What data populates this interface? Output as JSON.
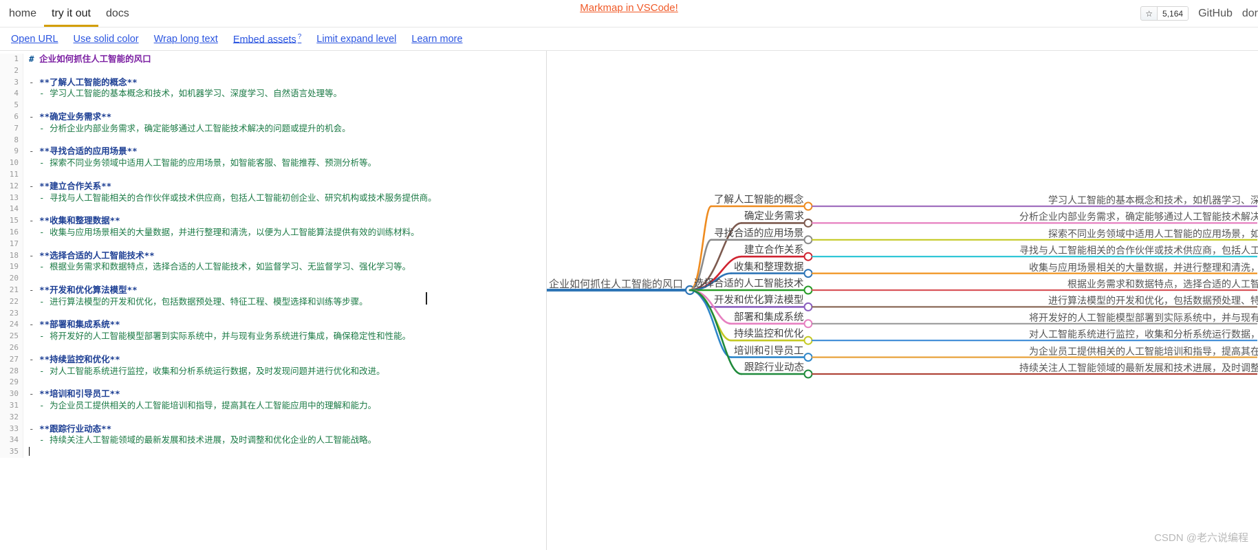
{
  "nav": {
    "items": [
      {
        "label": "home",
        "active": false
      },
      {
        "label": "try it out",
        "active": true
      },
      {
        "label": "docs",
        "active": false
      }
    ],
    "promo": "Markmap in VSCode!",
    "star_icon": "star-icon",
    "star_count": "5,164",
    "github": "GitHub",
    "donate": "dor"
  },
  "toolbar": {
    "open_url": "Open URL",
    "use_solid_color": "Use solid color",
    "wrap_long_text": "Wrap long text",
    "embed_assets": "Embed assets",
    "embed_assets_help": "?",
    "limit_expand_level": "Limit expand level",
    "learn_more": "Learn more"
  },
  "editor": {
    "lines": [
      {
        "n": "1",
        "segments": [
          {
            "t": "# ",
            "c": "tok-hash"
          },
          {
            "t": "企业如何抓住人工智能的风口",
            "c": "tok-head"
          }
        ]
      },
      {
        "n": "2",
        "segments": []
      },
      {
        "n": "3",
        "segments": [
          {
            "t": "- ",
            "c": "tok-mark"
          },
          {
            "t": "**了解人工智能的概念**",
            "c": "tok-bold"
          }
        ]
      },
      {
        "n": "4",
        "segments": [
          {
            "t": "  - 学习人工智能的基本概念和技术，如机器学习、深度学习、自然语言处理等。",
            "c": "tok-plain"
          }
        ]
      },
      {
        "n": "5",
        "segments": []
      },
      {
        "n": "6",
        "segments": [
          {
            "t": "- ",
            "c": "tok-mark"
          },
          {
            "t": "**确定业务需求**",
            "c": "tok-bold"
          }
        ]
      },
      {
        "n": "7",
        "segments": [
          {
            "t": "  - 分析企业内部业务需求，确定能够通过人工智能技术解决的问题或提升的机会。",
            "c": "tok-plain"
          }
        ]
      },
      {
        "n": "8",
        "segments": []
      },
      {
        "n": "9",
        "segments": [
          {
            "t": "- ",
            "c": "tok-mark"
          },
          {
            "t": "**寻找合适的应用场景**",
            "c": "tok-bold"
          }
        ]
      },
      {
        "n": "10",
        "segments": [
          {
            "t": "  - 探索不同业务领域中适用人工智能的应用场景，如智能客服、智能推荐、预测分析等。",
            "c": "tok-plain"
          }
        ]
      },
      {
        "n": "11",
        "segments": []
      },
      {
        "n": "12",
        "segments": [
          {
            "t": "- ",
            "c": "tok-mark"
          },
          {
            "t": "**建立合作关系**",
            "c": "tok-bold"
          }
        ]
      },
      {
        "n": "13",
        "segments": [
          {
            "t": "  - 寻找与人工智能相关的合作伙伴或技术供应商，包括人工智能初创企业、研究机构或技术服务提供商。",
            "c": "tok-plain"
          }
        ]
      },
      {
        "n": "14",
        "segments": []
      },
      {
        "n": "15",
        "segments": [
          {
            "t": "- ",
            "c": "tok-mark"
          },
          {
            "t": "**收集和整理数据**",
            "c": "tok-bold"
          }
        ]
      },
      {
        "n": "16",
        "segments": [
          {
            "t": "  - 收集与应用场景相关的大量数据，并进行整理和清洗，以便为人工智能算法提供有效的训练材料。",
            "c": "tok-plain"
          }
        ]
      },
      {
        "n": "17",
        "segments": []
      },
      {
        "n": "18",
        "segments": [
          {
            "t": "- ",
            "c": "tok-mark"
          },
          {
            "t": "**选择合适的人工智能技术**",
            "c": "tok-bold"
          }
        ]
      },
      {
        "n": "19",
        "segments": [
          {
            "t": "  - 根据业务需求和数据特点，选择合适的人工智能技术，如监督学习、无监督学习、强化学习等。",
            "c": "tok-plain"
          }
        ]
      },
      {
        "n": "20",
        "segments": []
      },
      {
        "n": "21",
        "segments": [
          {
            "t": "- ",
            "c": "tok-mark"
          },
          {
            "t": "**开发和优化算法模型**",
            "c": "tok-bold"
          }
        ]
      },
      {
        "n": "22",
        "segments": [
          {
            "t": "  - 进行算法模型的开发和优化，包括数据预处理、特征工程、模型选择和训练等步骤。",
            "c": "tok-plain"
          }
        ]
      },
      {
        "n": "23",
        "segments": []
      },
      {
        "n": "24",
        "segments": [
          {
            "t": "- ",
            "c": "tok-mark"
          },
          {
            "t": "**部署和集成系统**",
            "c": "tok-bold"
          }
        ]
      },
      {
        "n": "25",
        "segments": [
          {
            "t": "  - 将开发好的人工智能模型部署到实际系统中，并与现有业务系统进行集成，确保稳定性和性能。",
            "c": "tok-plain"
          }
        ]
      },
      {
        "n": "26",
        "segments": []
      },
      {
        "n": "27",
        "segments": [
          {
            "t": "- ",
            "c": "tok-mark"
          },
          {
            "t": "**持续监控和优化**",
            "c": "tok-bold"
          }
        ]
      },
      {
        "n": "28",
        "segments": [
          {
            "t": "  - 对人工智能系统进行监控，收集和分析系统运行数据，及时发现问题并进行优化和改进。",
            "c": "tok-plain"
          }
        ]
      },
      {
        "n": "29",
        "segments": []
      },
      {
        "n": "30",
        "segments": [
          {
            "t": "- ",
            "c": "tok-mark"
          },
          {
            "t": "**培训和引导员工**",
            "c": "tok-bold"
          }
        ]
      },
      {
        "n": "31",
        "segments": [
          {
            "t": "  - 为企业员工提供相关的人工智能培训和指导，提高其在人工智能应用中的理解和能力。",
            "c": "tok-plain"
          }
        ]
      },
      {
        "n": "32",
        "segments": []
      },
      {
        "n": "33",
        "segments": [
          {
            "t": "- ",
            "c": "tok-mark"
          },
          {
            "t": "**跟踪行业动态**",
            "c": "tok-bold"
          }
        ]
      },
      {
        "n": "34",
        "segments": [
          {
            "t": "  - 持续关注人工智能领域的最新发展和技术进展，及时调整和优化企业的人工智能战略。",
            "c": "tok-plain"
          }
        ]
      },
      {
        "n": "35",
        "segments": [
          {
            "t": "",
            "c": "tok-plain",
            "caret": true
          }
        ]
      }
    ]
  },
  "mindmap": {
    "root": {
      "label": "企业如何抓住人工智能的风口",
      "color": "#2e75b6"
    },
    "branches": [
      {
        "label": "了解人工智能的概念",
        "color": "#ee8b1f",
        "node_color": "#ee8b1f",
        "child": {
          "label": "学习人工智能的基本概念和技术，如机器学习、深",
          "color": "#a06fbe"
        }
      },
      {
        "label": "确定业务需求",
        "color": "#7d5a4f",
        "node_color": "#7d5a4f",
        "child": {
          "label": "分析企业内部业务需求，确定能够通过人工智能技术解决",
          "color": "#e67fc0"
        }
      },
      {
        "label": "寻找合适的应用场景",
        "color": "#8a8a8a",
        "node_color": "#8a8a8a",
        "child": {
          "label": "探索不同业务领域中适用人工智能的应用场景，如",
          "color": "#c4c923"
        }
      },
      {
        "label": "建立合作关系",
        "color": "#cf2330",
        "node_color": "#cf2330",
        "child": {
          "label": "寻找与人工智能相关的合作伙伴或技术供应商，包括人工",
          "color": "#24c3d4"
        }
      },
      {
        "label": "收集和整理数据",
        "color": "#2e75b6",
        "node_color": "#2e75b6",
        "child": {
          "label": "收集与应用场景相关的大量数据，并进行整理和清洗，",
          "color": "#f0931f"
        }
      },
      {
        "label": "选择合适的人工智能技术",
        "color": "#279b27",
        "node_color": "#279b27",
        "child": {
          "label": "根据业务需求和数据特点，选择合适的人工智",
          "color": "#d9545a"
        }
      },
      {
        "label": "开发和优化算法模型",
        "color": "#8a5fbe",
        "node_color": "#8a5fbe",
        "child": {
          "label": "进行算法模型的开发和优化，包括数据预处理、特",
          "color": "#8a6a58"
        }
      },
      {
        "label": "部署和集成系统",
        "color": "#e67fc0",
        "node_color": "#e67fc0",
        "child": {
          "label": "将开发好的人工智能模型部署到实际系统中，并与现有",
          "color": "#9a9a9a"
        }
      },
      {
        "label": "持续监控和优化",
        "color": "#c4c923",
        "node_color": "#c4c923",
        "child": {
          "label": "对人工智能系统进行监控，收集和分析系统运行数据，",
          "color": "#3b8ad6"
        }
      },
      {
        "label": "培训和引导员工",
        "color": "#2e86c9",
        "node_color": "#2e86c9",
        "child": {
          "label": "为企业员工提供相关的人工智能培训和指导，提高其在",
          "color": "#e8a33d"
        }
      },
      {
        "label": "跟踪行业动态",
        "color": "#1f8a3b",
        "node_color": "#1f8a3b",
        "child": {
          "label": "持续关注人工智能领域的最新发展和技术进展，及时调整",
          "color": "#b0453a"
        }
      }
    ]
  },
  "watermark": "CSDN @老六说编程"
}
